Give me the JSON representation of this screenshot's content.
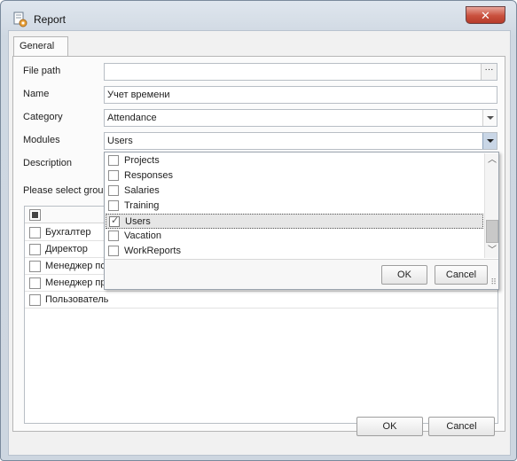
{
  "window": {
    "title": "Report",
    "close_glyph": "✕"
  },
  "tabs": [
    {
      "label": "General",
      "active": true
    }
  ],
  "form": {
    "file_path": {
      "label": "File path",
      "value": "",
      "browse_label": "···"
    },
    "name": {
      "label": "Name",
      "value": "Учет времени"
    },
    "category": {
      "label": "Category",
      "value": "Attendance"
    },
    "modules": {
      "label": "Modules",
      "value": "Users"
    },
    "description": {
      "label": "Description",
      "value": ""
    },
    "groups_prompt": "Please select group"
  },
  "groups": {
    "rows": [
      {
        "label": "Бухгалтер",
        "checked": false
      },
      {
        "label": "Директор",
        "checked": false
      },
      {
        "label": "Менеджер по",
        "checked": false
      },
      {
        "label": "Менеджер пр",
        "checked": false
      },
      {
        "label": "Пользователь",
        "checked": false
      }
    ]
  },
  "modules_popup": {
    "items": [
      {
        "label": "Projects",
        "checked": false
      },
      {
        "label": "Responses",
        "checked": false
      },
      {
        "label": "Salaries",
        "checked": false
      },
      {
        "label": "Training",
        "checked": false
      },
      {
        "label": "Users",
        "checked": true
      },
      {
        "label": "Vacation",
        "checked": false
      },
      {
        "label": "WorkReports",
        "checked": false
      }
    ],
    "selected_index": 4,
    "ok_label": "OK",
    "cancel_label": "Cancel"
  },
  "footer": {
    "ok_label": "OK",
    "cancel_label": "Cancel"
  },
  "colors": {
    "frame": "#cdd6e0",
    "close": "#c9503d",
    "selection": "#e6e6e6"
  },
  "icons": [
    "report-app-icon",
    "close-icon",
    "chevron-down-icon",
    "check-icon",
    "scroll-up-icon",
    "scroll-down-icon",
    "resize-grip-icon"
  ]
}
